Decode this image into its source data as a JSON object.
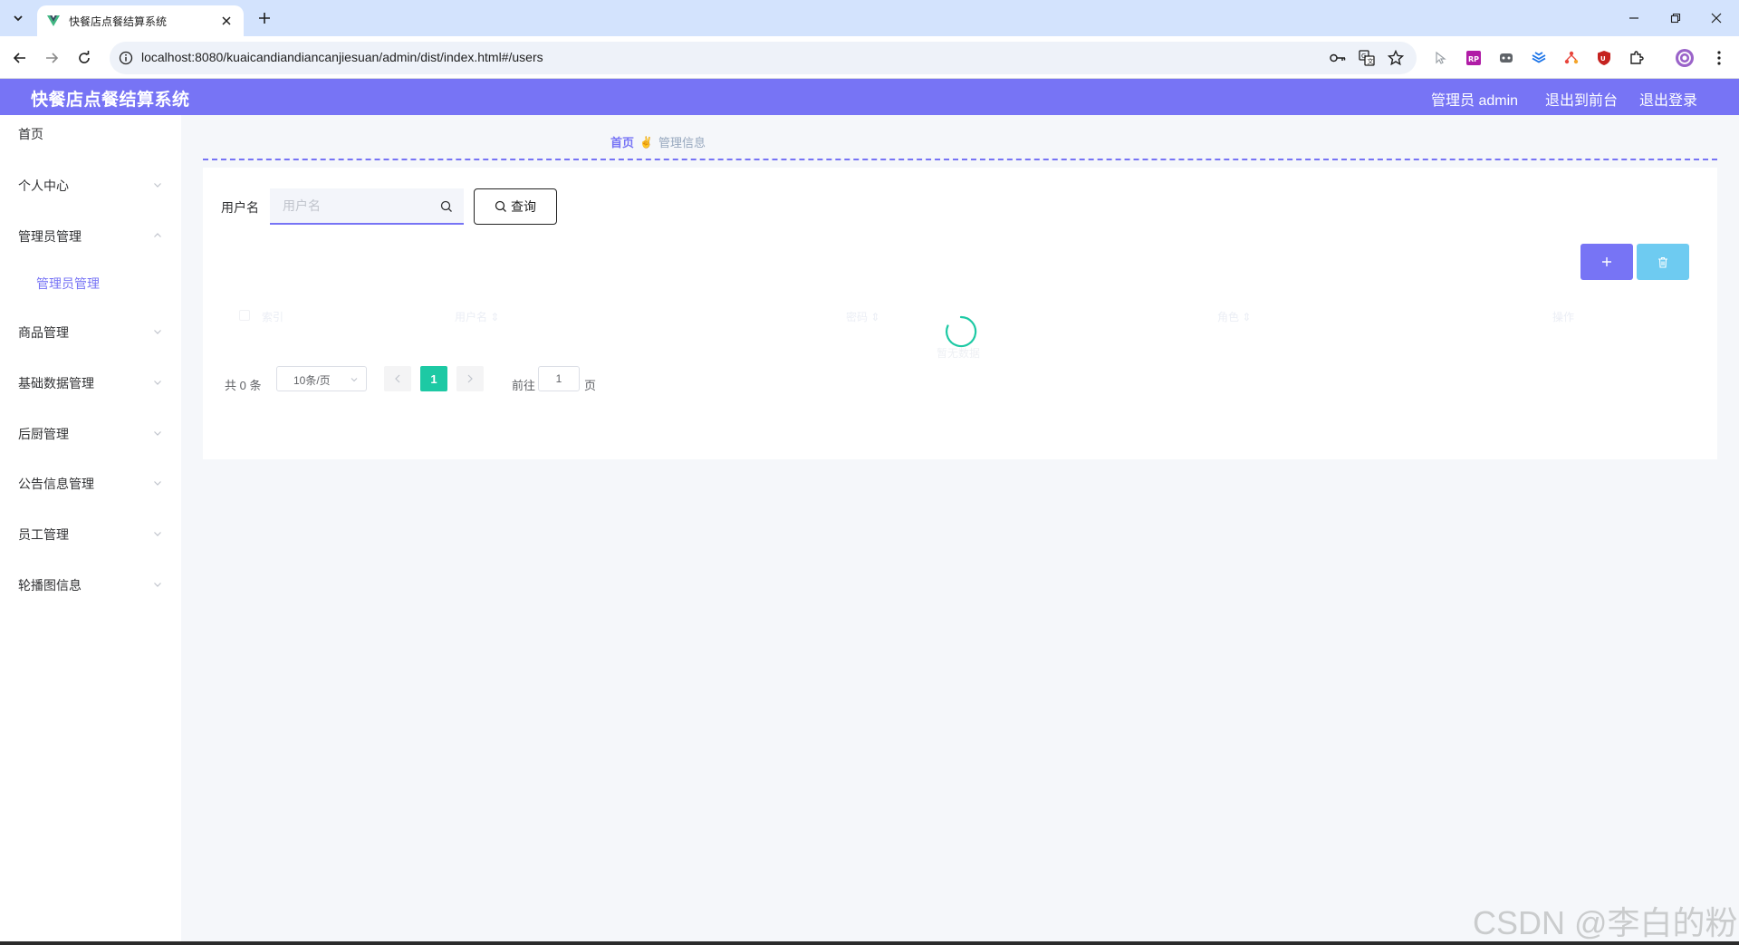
{
  "browser": {
    "tab_title": "快餐店点餐结算系统",
    "url": "localhost:8080/kuaicandiandiancanjiesuan/admin/dist/index.html#/users"
  },
  "header": {
    "title": "快餐店点餐结算系统",
    "user_label": "管理员 admin",
    "to_front": "退出到前台",
    "logout": "退出登录"
  },
  "sidebar": {
    "items": [
      {
        "label": "首页"
      },
      {
        "label": "个人中心"
      },
      {
        "label": "管理员管理"
      },
      {
        "label": "管理员管理"
      },
      {
        "label": "商品管理"
      },
      {
        "label": "基础数据管理"
      },
      {
        "label": "后厨管理"
      },
      {
        "label": "公告信息管理"
      },
      {
        "label": "员工管理"
      },
      {
        "label": "轮播图信息"
      }
    ]
  },
  "breadcrumb": {
    "home": "首页",
    "separator": "✌",
    "current": "管理信息"
  },
  "search": {
    "label": "用户名",
    "placeholder": "用户名",
    "value": "",
    "button": "查询"
  },
  "table": {
    "columns": [
      "索引",
      "用户名 ⇕",
      "密码 ⇕",
      "角色 ⇕",
      "操作"
    ],
    "empty_text": "暂无数据"
  },
  "pagination": {
    "total": "共 0 条",
    "page_size": "10条/页",
    "current_page": "1",
    "goto_label": "前往",
    "goto_value": "1",
    "goto_unit": "页"
  },
  "watermark": "CSDN @李白的粉",
  "colors": {
    "primary": "#7774f5",
    "info": "#6ecbf1",
    "page_active": "#1dc9a4"
  }
}
